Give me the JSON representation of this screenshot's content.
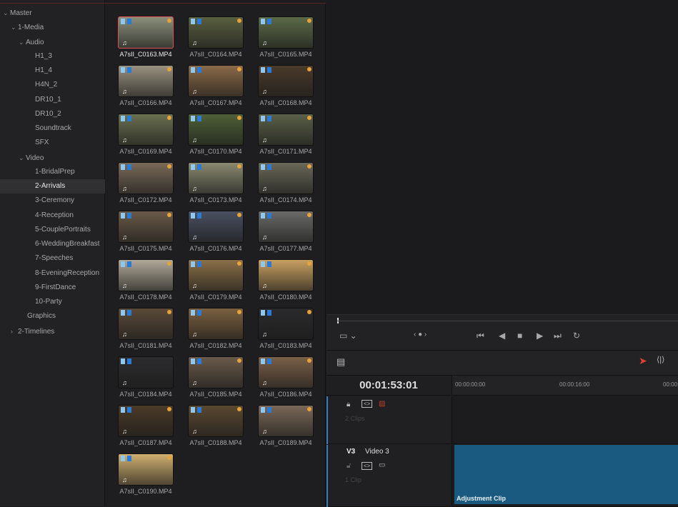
{
  "sidebar": {
    "items": [
      {
        "label": "Master",
        "level": 0,
        "chevron": "v"
      },
      {
        "label": "1-Media",
        "level": 1,
        "chevron": "v"
      },
      {
        "label": "Audio",
        "level": 2,
        "chevron": "v"
      },
      {
        "label": "H1_3",
        "level": 3
      },
      {
        "label": "H1_4",
        "level": 3
      },
      {
        "label": "H4N_2",
        "level": 3
      },
      {
        "label": "DR10_1",
        "level": 3
      },
      {
        "label": "DR10_2",
        "level": 3
      },
      {
        "label": "Soundtrack",
        "level": 3
      },
      {
        "label": "SFX",
        "level": 3
      },
      {
        "label": "Video",
        "level": 2,
        "chevron": "v"
      },
      {
        "label": "1-BridalPrep",
        "level": 3
      },
      {
        "label": "2-Arrivals",
        "level": 3,
        "selected": true
      },
      {
        "label": "3-Ceremony",
        "level": 3
      },
      {
        "label": "4-Reception",
        "level": 3
      },
      {
        "label": "5-CouplePortraits",
        "level": 3
      },
      {
        "label": "6-WeddingBreakfast",
        "level": 3
      },
      {
        "label": "7-Speeches",
        "level": 3
      },
      {
        "label": "8-EveningReception",
        "level": 3
      },
      {
        "label": "9-FirstDance",
        "level": 3
      },
      {
        "label": "10-Party",
        "level": 3
      },
      {
        "label": "Graphics",
        "level": 2
      },
      {
        "label": "2-Timelines",
        "level": 1,
        "chevron": ">"
      }
    ]
  },
  "clips": [
    {
      "name": "A7sII_C0163.MP4",
      "tone": "#8a8f7a",
      "selected": true
    },
    {
      "name": "A7sII_C0164.MP4",
      "tone": "#5a6040"
    },
    {
      "name": "A7sII_C0165.MP4",
      "tone": "#5c6a48"
    },
    {
      "name": "A7sII_C0166.MP4",
      "tone": "#9a9280"
    },
    {
      "name": "A7sII_C0167.MP4",
      "tone": "#8a6a48"
    },
    {
      "name": "A7sII_C0168.MP4",
      "tone": "#4a3a2a"
    },
    {
      "name": "A7sII_C0169.MP4",
      "tone": "#6a7050"
    },
    {
      "name": "A7sII_C0170.MP4",
      "tone": "#4e6038"
    },
    {
      "name": "A7sII_C0171.MP4",
      "tone": "#5a6048"
    },
    {
      "name": "A7sII_C0172.MP4",
      "tone": "#7a6a58"
    },
    {
      "name": "A7sII_C0173.MP4",
      "tone": "#8a8a70"
    },
    {
      "name": "A7sII_C0174.MP4",
      "tone": "#6a6858"
    },
    {
      "name": "A7sII_C0175.MP4",
      "tone": "#6a5a48"
    },
    {
      "name": "A7sII_C0176.MP4",
      "tone": "#4a5060"
    },
    {
      "name": "A7sII_C0177.MP4",
      "tone": "#6a6a68"
    },
    {
      "name": "A7sII_C0178.MP4",
      "tone": "#b0a898"
    },
    {
      "name": "A7sII_C0179.MP4",
      "tone": "#8a7048"
    },
    {
      "name": "A7sII_C0180.MP4",
      "tone": "#c8a060"
    },
    {
      "name": "A7sII_C0181.MP4",
      "tone": "#5a4a38"
    },
    {
      "name": "A7sII_C0182.MP4",
      "tone": "#7a6040"
    },
    {
      "name": "A7sII_C0183.MP4",
      "tone": "#2a2a2c"
    },
    {
      "name": "A7sII_C0184.MP4",
      "tone": "#2c2c2e"
    },
    {
      "name": "A7sII_C0185.MP4",
      "tone": "#6a5a4a"
    },
    {
      "name": "A7sII_C0186.MP4",
      "tone": "#7a6048"
    },
    {
      "name": "A7sII_C0187.MP4",
      "tone": "#4a3a28"
    },
    {
      "name": "A7sII_C0188.MP4",
      "tone": "#5a4830"
    },
    {
      "name": "A7sII_C0189.MP4",
      "tone": "#7a6858"
    },
    {
      "name": "A7sII_C0190.MP4",
      "tone": "#d0b070"
    }
  ],
  "transport": {
    "buttons": [
      "jump-start",
      "play-reverse",
      "stop",
      "play",
      "jump-end",
      "loop"
    ]
  },
  "timeline": {
    "timecode": "00:01:53:01",
    "ruler": [
      "00:00:00:00",
      "00:00:16:00",
      "00:00:"
    ],
    "tracks": [
      {
        "id": "",
        "name": "",
        "clips": "2 Clips"
      },
      {
        "id": "V3",
        "name": "Video 3",
        "clips": "1 Clip",
        "clip_label": "Adjustment Clip",
        "clip_color": "#1a5a80"
      }
    ]
  },
  "colors": {
    "flag_light": "#8ec8f0",
    "flag_blue": "#2a7ad8",
    "clip_dot": "#e8a23a",
    "selection": "#e05050"
  }
}
